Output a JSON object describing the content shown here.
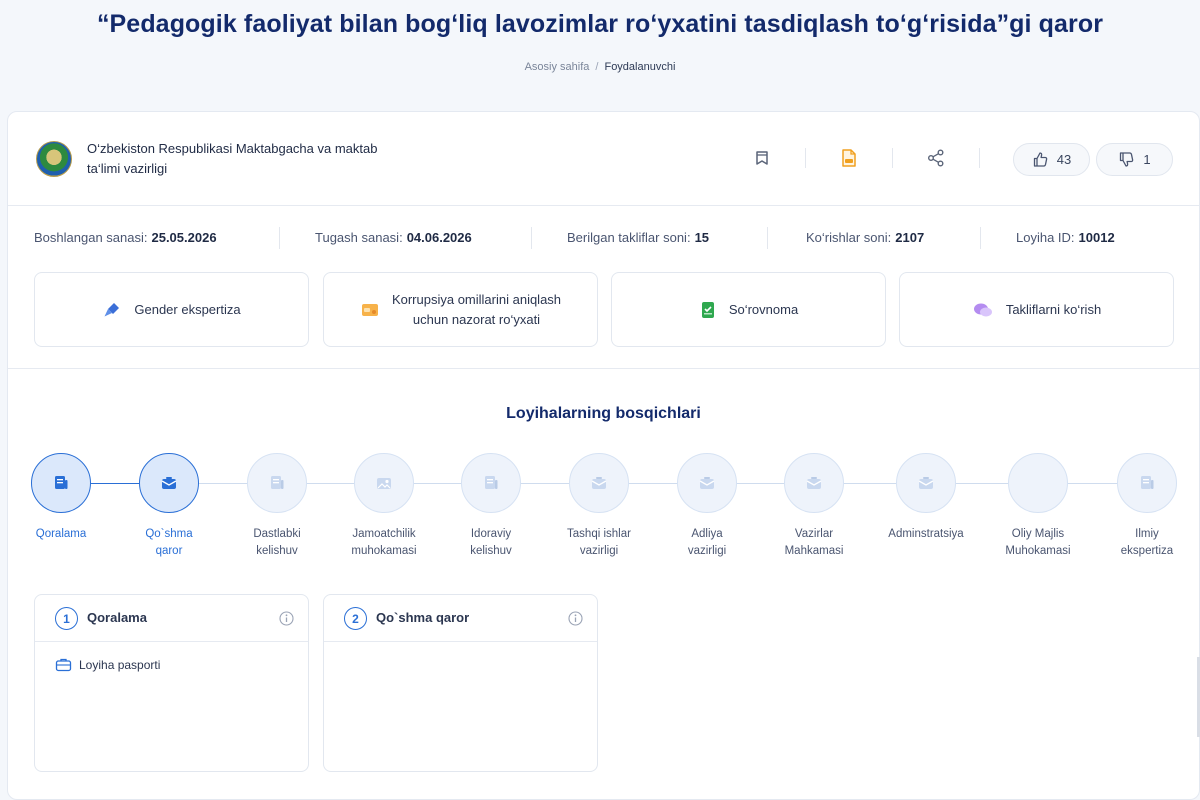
{
  "page": {
    "title": "“Pedagogik faoliyat bilan bog‘liq lavozimlar ro‘yxatini tasdiqlash to‘g‘risida”gi qaror",
    "breadcrumb": {
      "home": "Asosiy sahifa",
      "separator": "/",
      "current": "Foydalanuvchi"
    }
  },
  "header": {
    "ministry_line1": "O‘zbekiston Respublikasi Maktabgacha va maktab",
    "ministry_line2": "ta‘limi vazirligi",
    "likes": "43",
    "dislikes": "1"
  },
  "stats": [
    {
      "label": "Boshlangan sanasi:",
      "value": "25.05.2026"
    },
    {
      "label": "Tugash sanasi:",
      "value": "04.06.2026"
    },
    {
      "label": "Berilgan takliflar soni:",
      "value": "15"
    },
    {
      "label": "Ko‘rishlar soni:",
      "value": "2107"
    },
    {
      "label": "Loyiha ID:",
      "value": "10012"
    }
  ],
  "actions": {
    "gender": "Gender ekspertiza",
    "corruption_line1": "Korrupsiya omillarini aniqlash",
    "corruption_line2": "uchun nazorat ro‘yxati",
    "survey": "So‘rovnoma",
    "proposals": "Takliflarni ko‘rish"
  },
  "stages_title": "Loyihalarning bosqichlari",
  "stages": [
    {
      "line1": "Qoralama",
      "line2": ""
    },
    {
      "line1": "Qo`shma",
      "line2": "qaror"
    },
    {
      "line1": "Dastlabki",
      "line2": "kelishuv"
    },
    {
      "line1": "Jamoatchilik",
      "line2": "muhokamasi"
    },
    {
      "line1": "Idoraviy",
      "line2": "kelishuv"
    },
    {
      "line1": "Tashqi ishlar",
      "line2": "vazirligi"
    },
    {
      "line1": "Adliya",
      "line2": "vazirligi"
    },
    {
      "line1": "Vazirlar",
      "line2": "Mahkamasi"
    },
    {
      "line1": "Adminstratsiya",
      "line2": ""
    },
    {
      "line1": "Oliy Majlis",
      "line2": "Muhokamasi"
    },
    {
      "line1": "Ilmiy",
      "line2": "ekspertiza"
    }
  ],
  "panels": [
    {
      "number": "1",
      "title": "Qoralama",
      "item": "Loyiha pasporti"
    },
    {
      "number": "2",
      "title": "Qo`shma qaror"
    }
  ],
  "colors": {
    "accent": "#2a6fd6",
    "title": "#132a6b",
    "pdf": "#f0a020"
  }
}
